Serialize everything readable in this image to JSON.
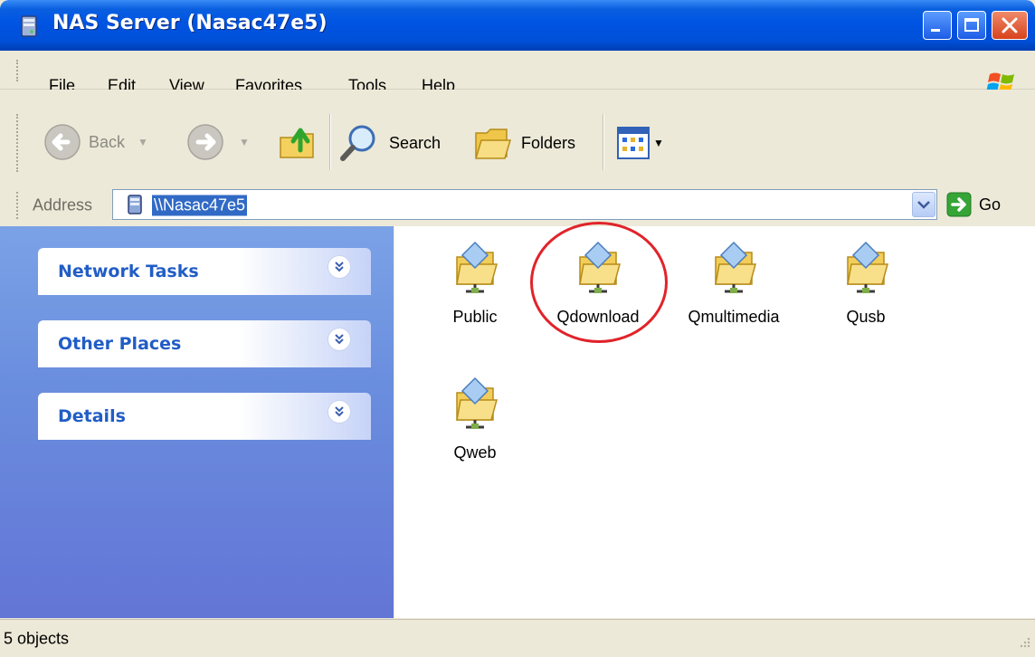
{
  "window": {
    "title": "NAS Server (Nasac47e5)"
  },
  "menu": {
    "items": [
      {
        "label": "File"
      },
      {
        "label": "Edit"
      },
      {
        "label": "View"
      },
      {
        "label": "Favorites"
      },
      {
        "label": "Tools"
      },
      {
        "label": "Help"
      }
    ]
  },
  "toolbar": {
    "back_label": "Back",
    "search_label": "Search",
    "folders_label": "Folders"
  },
  "address": {
    "label": "Address",
    "value": "\\\\Nasac47e5",
    "go_label": "Go"
  },
  "taskpane": {
    "sections": [
      {
        "title": "Network Tasks"
      },
      {
        "title": "Other Places"
      },
      {
        "title": "Details"
      }
    ]
  },
  "shares": [
    {
      "name": "Public"
    },
    {
      "name": "Qdownload",
      "highlighted": true
    },
    {
      "name": "Qmultimedia"
    },
    {
      "name": "Qusb"
    },
    {
      "name": "Qweb"
    }
  ],
  "status": {
    "text": "5 objects"
  },
  "colors": {
    "titlebar": "#0054e3",
    "taskpane": "#6a8ede",
    "task_title": "#215dc6",
    "highlight_circle": "#e0242a",
    "selection": "#316ac5"
  }
}
